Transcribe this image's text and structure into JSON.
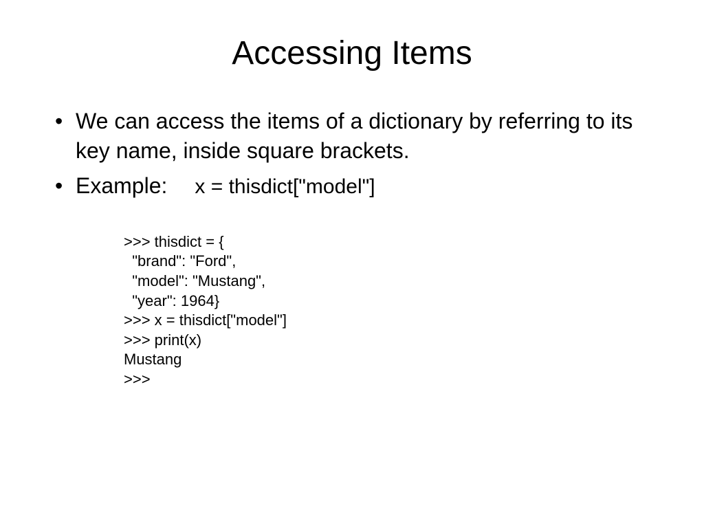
{
  "title": "Accessing Items",
  "bullets": {
    "item1": "We can access the items of a dictionary by referring to its key name, inside square brackets.",
    "item2_label": "Example:",
    "item2_code": "x = thisdict[\"model\"]"
  },
  "code": ">>> thisdict = {\n  \"brand\": \"Ford\",\n  \"model\": \"Mustang\",\n  \"year\": 1964}\n>>> x = thisdict[\"model\"]\n>>> print(x)\nMustang\n>>>"
}
